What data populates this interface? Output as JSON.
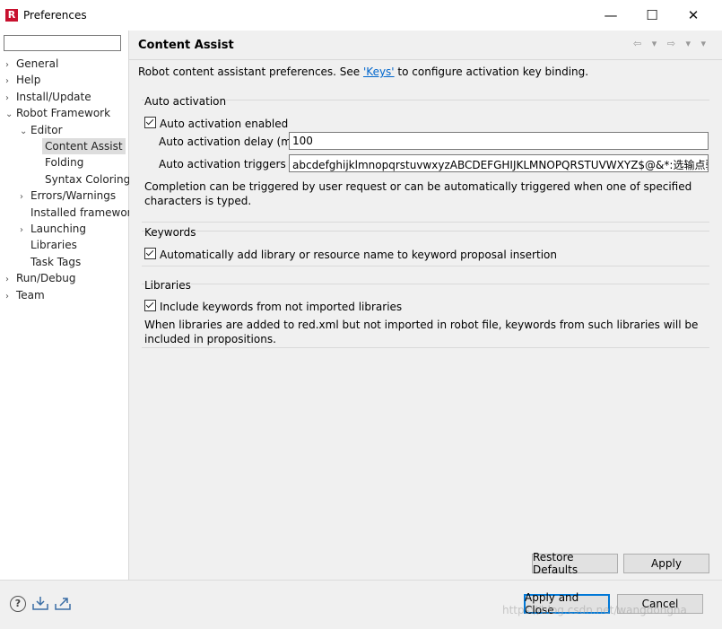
{
  "window": {
    "title": "Preferences",
    "logo_letter": "R",
    "minimize_glyph": "—",
    "maximize_glyph": "☐",
    "close_glyph": "✕"
  },
  "sidebar": {
    "filter_value": "",
    "items": [
      {
        "label": "General",
        "arrow": "›",
        "level": 0
      },
      {
        "label": "Help",
        "arrow": "›",
        "level": 0
      },
      {
        "label": "Install/Update",
        "arrow": "›",
        "level": 0
      },
      {
        "label": "Robot Framework",
        "arrow": "⌄",
        "level": 0
      },
      {
        "label": "Editor",
        "arrow": "⌄",
        "level": 1
      },
      {
        "label": "Content Assist",
        "arrow": "",
        "level": 2,
        "selected": true
      },
      {
        "label": "Folding",
        "arrow": "",
        "level": 2
      },
      {
        "label": "Syntax Coloring",
        "arrow": "",
        "level": 2
      },
      {
        "label": "Errors/Warnings",
        "arrow": "›",
        "level": 1
      },
      {
        "label": "Installed frameworks",
        "arrow": "",
        "level": 1
      },
      {
        "label": "Launching",
        "arrow": "›",
        "level": 1
      },
      {
        "label": "Libraries",
        "arrow": "",
        "level": 1
      },
      {
        "label": "Task Tags",
        "arrow": "",
        "level": 1
      },
      {
        "label": "Run/Debug",
        "arrow": "›",
        "level": 0
      },
      {
        "label": "Team",
        "arrow": "›",
        "level": 0
      }
    ]
  },
  "page": {
    "title": "Content Assist",
    "nav_icons": "⇦ ▾ ⇨ ▾ ▾",
    "description_before": "Robot content assistant preferences. See ",
    "description_link": "'Keys'",
    "description_after": " to configure activation key binding."
  },
  "auto_activation": {
    "group_title": "Auto activation",
    "enabled_label": "Auto activation enabled",
    "enabled": true,
    "delay_label": "Auto activation delay (ms)",
    "delay_value": "100",
    "triggers_label": "Auto activation triggers",
    "triggers_value": "abcdefghijklmnopqrstuvwxyzABCDEFGHIJKLMNOPQRSTUVWXYZ$@&*:选输点验等",
    "note": "Completion can be triggered by user request or can be automatically triggered when one of specified characters is typed."
  },
  "keywords": {
    "group_title": "Keywords",
    "add_label": "Automatically add library or resource name to keyword proposal insertion",
    "checked": true
  },
  "libraries": {
    "group_title": "Libraries",
    "include_label": "Include keywords from not imported libraries",
    "checked": true,
    "note": "When libraries are added to red.xml but not imported in robot file, keywords from such libraries will be included in propositions."
  },
  "buttons": {
    "restore_defaults": "Restore Defaults",
    "apply": "Apply",
    "apply_and_close": "Apply and Close",
    "cancel": "Cancel"
  },
  "bottom": {
    "help_glyph": "?",
    "watermark": "https://blog.csdn.net/wangdongha"
  },
  "colors": {
    "link": "#0066cc",
    "default_button_border": "#0078d7",
    "logo_red": "#c8102e"
  }
}
